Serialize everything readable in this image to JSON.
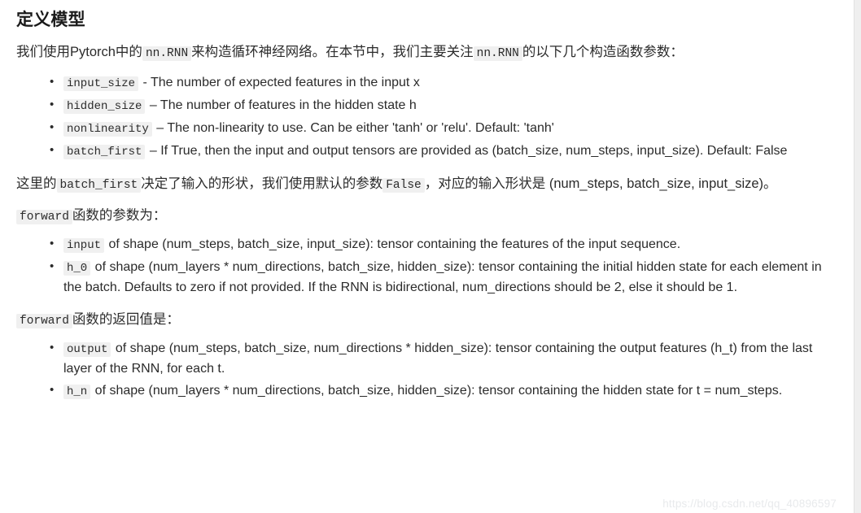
{
  "page": {
    "title": "定义模型",
    "watermark": "https://blog.csdn.net/qq_40896597",
    "code_bg": "#f0f0f0",
    "text_color": "#2b2b2b"
  },
  "intro": {
    "part1": "我们使用Pytorch中的",
    "code1": "nn.RNN",
    "part2": "来构造循环神经网络。在本节中，我们主要关注",
    "code2": "nn.RNN",
    "part3": "的以下几个构造函数参数："
  },
  "ctor_params": [
    {
      "code": "input_size",
      "desc": "- The number of expected features in the input x"
    },
    {
      "code": "hidden_size",
      "desc": "– The number of features in the hidden state h"
    },
    {
      "code": "nonlinearity",
      "desc": "– The non-linearity to use. Can be either 'tanh' or 'relu'. Default: 'tanh'"
    },
    {
      "code": "batch_first",
      "desc": "– If True, then the input and output tensors are provided as (batch_size, num_steps, input_size). Default: False"
    }
  ],
  "batch_first_note": {
    "part1": "这里的",
    "code1": "batch_first",
    "part2": "决定了输入的形状，我们使用默认的参数",
    "code2": "False",
    "part3": "，对应的输入形状是 (num_steps, batch_size, input_size)。"
  },
  "forward_args_heading": {
    "code": "forward",
    "text": "函数的参数为："
  },
  "forward_args": [
    {
      "code": "input",
      "desc": "of shape (num_steps, batch_size, input_size): tensor containing the features of the input sequence."
    },
    {
      "code": "h_0",
      "desc": "of shape (num_layers * num_directions, batch_size, hidden_size): tensor containing the initial hidden state for each element in the batch. Defaults to zero if not provided. If the RNN is bidirectional, num_directions should be 2, else it should be 1."
    }
  ],
  "forward_returns_heading": {
    "code": "forward",
    "text": "函数的返回值是："
  },
  "forward_returns": [
    {
      "code": "output",
      "desc": "of shape (num_steps, batch_size, num_directions * hidden_size): tensor containing the output features (h_t) from the last layer of the RNN, for each t."
    },
    {
      "code": "h_n",
      "desc": "of shape (num_layers * num_directions, batch_size, hidden_size): tensor containing the hidden state for t = num_steps."
    }
  ]
}
